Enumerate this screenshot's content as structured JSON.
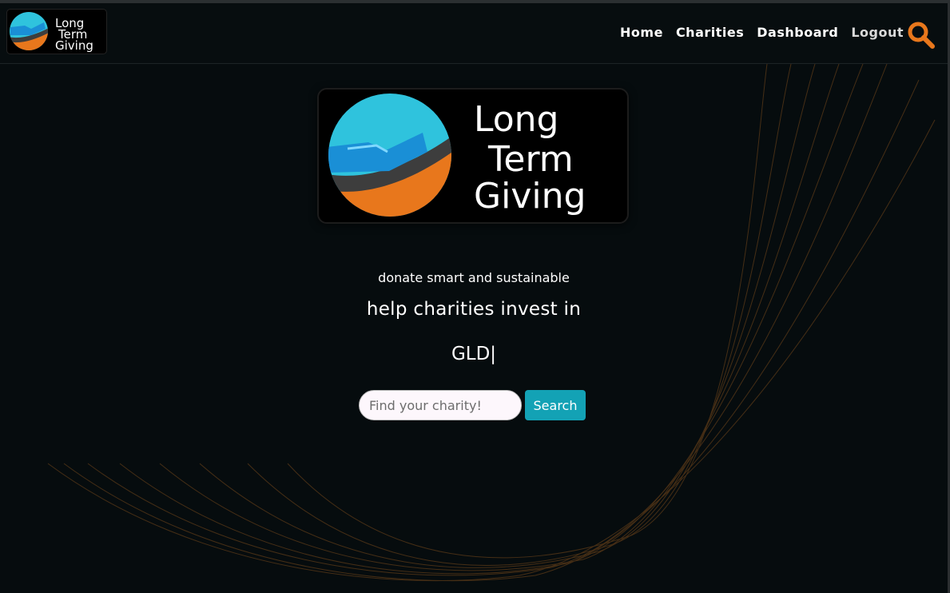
{
  "nav": {
    "logo_text": [
      "Long",
      "Term",
      "Giving"
    ],
    "links": [
      {
        "label": "Home"
      },
      {
        "label": "Charities"
      },
      {
        "label": "Dashboard"
      },
      {
        "label": "Logout"
      }
    ],
    "search_icon": "search-icon"
  },
  "hero": {
    "logo_text": [
      "Long",
      "Term",
      "Giving"
    ],
    "tagline": "donate smart and sustainable",
    "headline": "help charities invest in",
    "typed_text": "GLD|"
  },
  "search": {
    "placeholder": "Find your charity!",
    "value": "",
    "button_label": "Search"
  },
  "colors": {
    "background": "#060c0e",
    "accent_orange": "#e8771c",
    "accent_cyan": "#13a2b5",
    "logo_blue": "#2fc3dd"
  }
}
